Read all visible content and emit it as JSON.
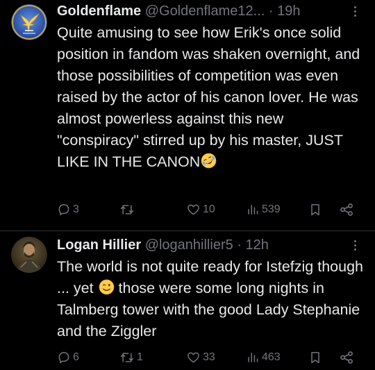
{
  "tweets": [
    {
      "display_name": "Goldenflame",
      "handle": "@Goldenflame12...",
      "separator": "·",
      "time": "19h",
      "text": "Quite amusing to see how Erik's once solid position in fandom was shaken overnight, and those possibilities of competition was even raised by the actor of his canon lover. He was almost powerless against this new \"conspiracy\" stirred up by his master, JUST LIKE IN THE CANON",
      "emoji": "rolling-on-floor-laughing-emoji",
      "replies": "3",
      "reposts": "",
      "likes": "10",
      "views": "539",
      "avatar_icon": "golden-bird-avatar"
    },
    {
      "display_name": "Logan Hillier",
      "handle": "@loganhillier5",
      "separator": "·",
      "time": "12h",
      "text_before_emoji": "The world is not quite ready for Istefzig though ... yet ",
      "text_after_emoji": " those were some long nights in Talmberg tower with the good Lady Stephanie and the Ziggler",
      "emoji": "winking-face-emoji",
      "replies": "6",
      "reposts": "1",
      "likes": "33",
      "views": "463",
      "avatar_icon": "knight-portrait-avatar"
    }
  ],
  "colors": {
    "background": "#000000",
    "text_primary": "#e7e9ea",
    "text_secondary": "#71767b",
    "divider": "#2f3336"
  }
}
